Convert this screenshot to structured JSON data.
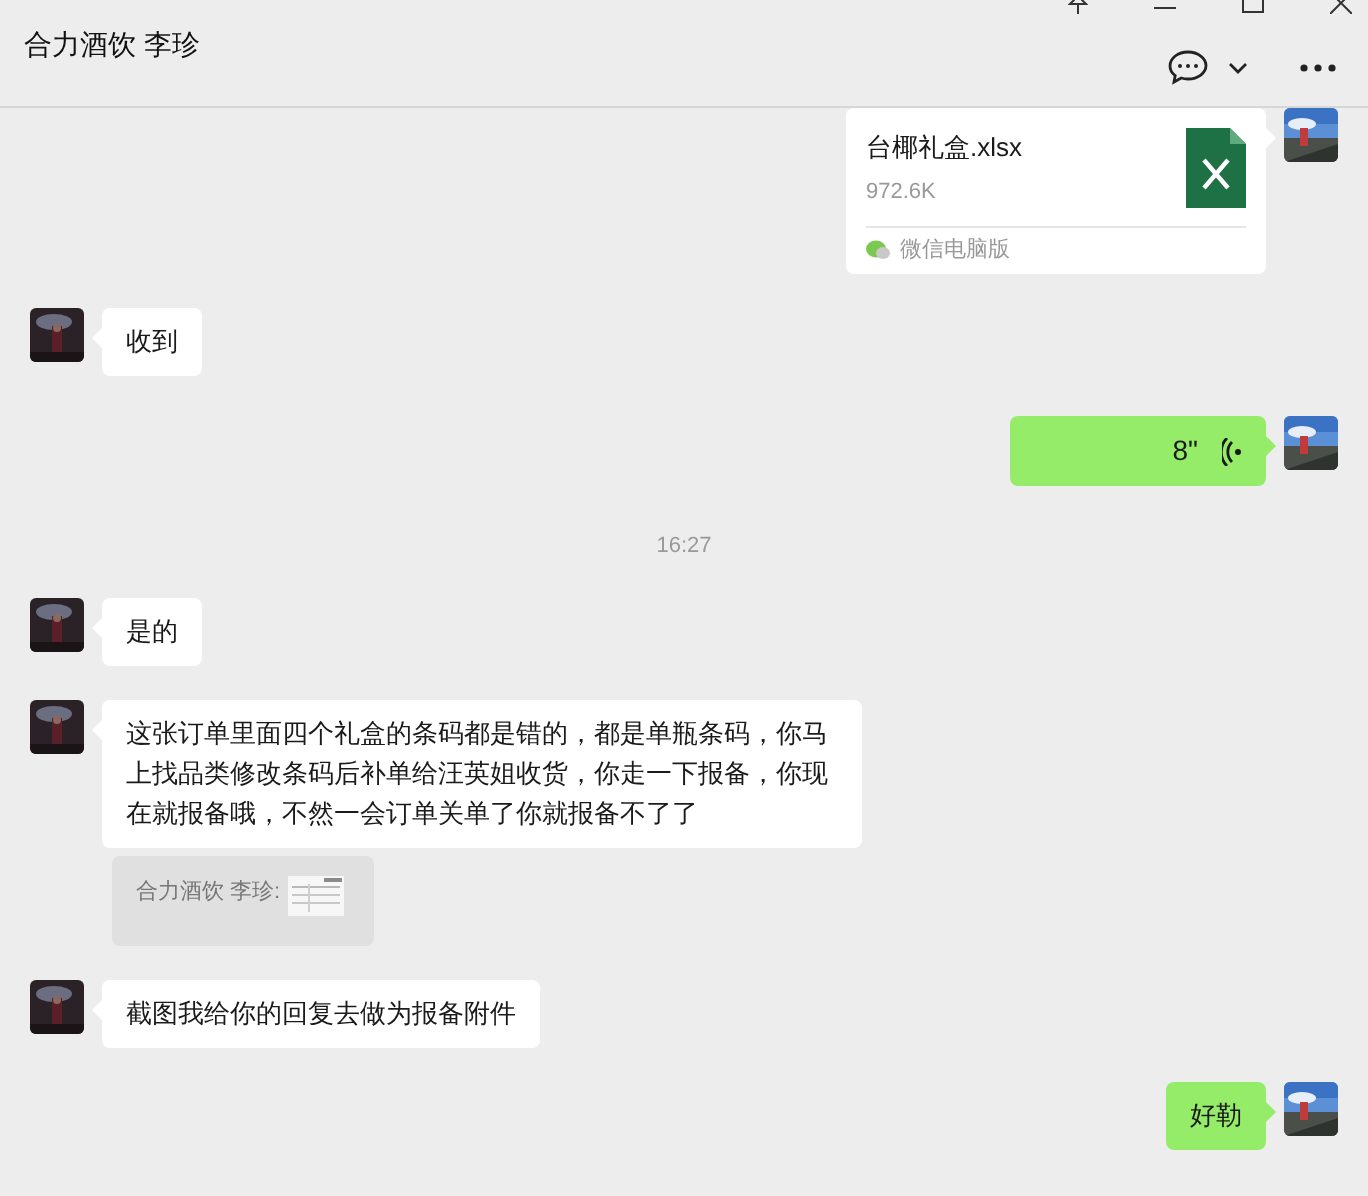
{
  "window": {
    "title": "合力酒饮 李珍"
  },
  "messages": [
    {
      "kind": "file",
      "outgoing": true,
      "name": "台椰礼盒.xlsx",
      "size": "972.6K",
      "source": "微信电脑版"
    },
    {
      "kind": "text",
      "outgoing": false,
      "text": "收到"
    },
    {
      "kind": "voice",
      "outgoing": true,
      "duration": "8\""
    },
    {
      "kind": "time",
      "text": "16:27"
    },
    {
      "kind": "text",
      "outgoing": false,
      "text": "是的"
    },
    {
      "kind": "text",
      "outgoing": false,
      "text": "这张订单里面四个礼盒的条码都是错的，都是单瓶条码，你马上找品类修改条码后补单给汪英姐收货，你走一下报备，你现在就报备哦，不然一会订单关单了你就报备不了了"
    },
    {
      "kind": "quote",
      "text": "合力酒饮 李珍:"
    },
    {
      "kind": "text",
      "outgoing": false,
      "text": "截图我给你的回复去做为报备附件"
    },
    {
      "kind": "text",
      "outgoing": true,
      "text": "好勒"
    }
  ]
}
